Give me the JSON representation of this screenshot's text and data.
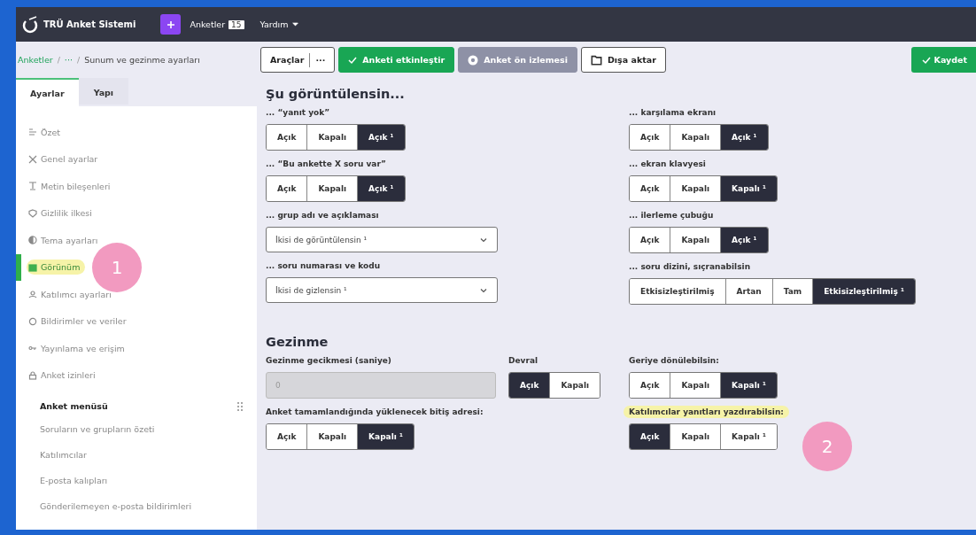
{
  "navbar": {
    "brand": "TRÜ Anket Sistemi",
    "menu": [
      {
        "kind": "count",
        "label": "Anketler",
        "badge": "15"
      },
      {
        "kind": "dropdown",
        "label": "Yardım"
      }
    ]
  },
  "breadcrumb_separator": "/",
  "breadcrumb": [
    {
      "label": "Anketler",
      "link": true
    },
    {
      "label": "···",
      "link": true
    },
    {
      "label": "Sunum ve gezinme ayarları",
      "link": false
    }
  ],
  "toolbar": [
    {
      "kind": "tools",
      "label": "Araçlar",
      "more": "···"
    },
    {
      "kind": "primary",
      "label": "Anketi etkinleştir"
    },
    {
      "kind": "disabled",
      "label": "Anket ön izlemesi"
    },
    {
      "kind": "export",
      "label": "Dışa aktar"
    }
  ],
  "save_button": {
    "label": "Kaydet"
  },
  "tabs": [
    {
      "label": "Ayarlar",
      "selected": true
    },
    {
      "label": "Yapı",
      "selected": false
    }
  ],
  "sidebar": {
    "items": [
      {
        "label": "Özet",
        "selected": false
      },
      {
        "label": "Genel ayarlar",
        "selected": false
      },
      {
        "label": "Metin bileşenleri",
        "selected": false
      },
      {
        "label": "Gizlilik ilkesi",
        "selected": false
      },
      {
        "label": "Tema ayarları",
        "selected": false
      },
      {
        "label": "Görünüm",
        "selected": true,
        "highlighted": true,
        "annotation": "1"
      },
      {
        "label": "Katılımcı ayarları",
        "selected": false
      },
      {
        "label": "Bildirimler ve veriler",
        "selected": false
      },
      {
        "label": "Yayınlama ve erişim",
        "selected": false
      },
      {
        "label": "Anket izinleri",
        "selected": false
      }
    ],
    "menu_title": "Anket menüsü",
    "menu_items": [
      "Soruların ve grupların özeti",
      "Katılımcılar",
      "E-posta kalıpları",
      "Gönderilemeyen e-posta bildirimleri"
    ]
  },
  "sections": [
    {
      "title": "Şu görüntülensin...",
      "columns": [
        {
          "fields": [
            {
              "kind": "toggle",
              "label": "... “yanıt yok”",
              "options": [
                {
                  "label": "Açık",
                  "selected": false
                },
                {
                  "label": "Kapalı",
                  "selected": false
                },
                {
                  "label": "Açık ¹",
                  "selected": true
                }
              ]
            },
            {
              "kind": "toggle",
              "label": "... “Bu ankette X soru var”",
              "options": [
                {
                  "label": "Açık",
                  "selected": false
                },
                {
                  "label": "Kapalı",
                  "selected": false
                },
                {
                  "label": "Açık ¹",
                  "selected": true
                }
              ]
            },
            {
              "kind": "select",
              "label": "... grup adı ve açıklaması",
              "value": "İkisi de görüntülensin ¹"
            },
            {
              "kind": "select",
              "label": "... soru numarası ve kodu",
              "value": "İkisi de gizlensin ¹"
            }
          ]
        },
        {
          "fields": [
            {
              "kind": "toggle",
              "label": "... karşılama ekranı",
              "options": [
                {
                  "label": "Açık",
                  "selected": false
                },
                {
                  "label": "Kapalı",
                  "selected": false
                },
                {
                  "label": "Açık ¹",
                  "selected": true
                }
              ]
            },
            {
              "kind": "toggle",
              "label": "... ekran klavyesi",
              "options": [
                {
                  "label": "Açık",
                  "selected": false
                },
                {
                  "label": "Kapalı",
                  "selected": false
                },
                {
                  "label": "Kapalı ¹",
                  "selected": true
                }
              ]
            },
            {
              "kind": "toggle",
              "label": "... ilerleme çubuğu",
              "options": [
                {
                  "label": "Açık",
                  "selected": false
                },
                {
                  "label": "Kapalı",
                  "selected": false
                },
                {
                  "label": "Açık ¹",
                  "selected": true
                }
              ]
            },
            {
              "kind": "toggle",
              "label": "... soru dizini, sıçranabilsin",
              "options": [
                {
                  "label": "Etkisizleştirilmiş",
                  "selected": false
                },
                {
                  "label": "Artan",
                  "selected": false
                },
                {
                  "label": "Tam",
                  "selected": false
                },
                {
                  "label": "Etkisizleştirilmiş ¹",
                  "selected": true
                }
              ]
            }
          ]
        }
      ]
    },
    {
      "title": "Gezinme",
      "columns": [
        {
          "fields": [
            {
              "kind": "input",
              "label": "Gezinme gecikmesi (saniye)",
              "value": "0",
              "disabled": true
            },
            {
              "kind": "toggle",
              "label": "Anket tamamlandığında yüklenecek bitiş adresi:",
              "options": [
                {
                  "label": "Açık",
                  "selected": false
                },
                {
                  "label": "Kapalı",
                  "selected": false
                },
                {
                  "label": "Kapalı ¹",
                  "selected": true
                }
              ]
            }
          ]
        },
        {
          "fields": [
            {
              "kind": "toggle",
              "label": "Devral",
              "options": [
                {
                  "label": "Açık",
                  "selected": true
                },
                {
                  "label": "Kapalı",
                  "selected": false
                }
              ]
            }
          ]
        },
        {
          "fields": [
            {
              "kind": "toggle",
              "label": "Geriye dönülebilsin:",
              "options": [
                {
                  "label": "Açık",
                  "selected": false
                },
                {
                  "label": "Kapalı",
                  "selected": false
                },
                {
                  "label": "Kapalı ¹",
                  "selected": true
                }
              ]
            },
            {
              "kind": "toggle",
              "label": "Katılımcılar yanıtları yazdırabilsin:",
              "highlighted": true,
              "annotation": "2",
              "options": [
                {
                  "label": "Açık",
                  "selected": true
                },
                {
                  "label": "Kapalı",
                  "selected": false
                },
                {
                  "label": "Kapalı ¹",
                  "selected": false
                }
              ]
            }
          ]
        }
      ]
    }
  ]
}
